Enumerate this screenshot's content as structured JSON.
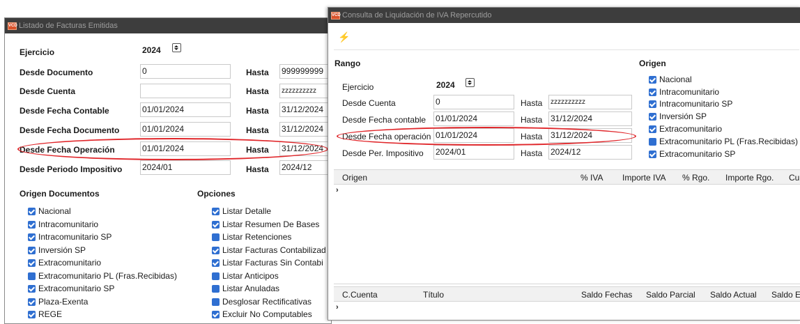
{
  "win1": {
    "title": "Listado de Facturas Emitidas",
    "ejercicio_label": "Ejercicio",
    "ejercicio_value": "2024",
    "hasta_label": "Hasta",
    "rows": [
      {
        "label": "Desde Documento",
        "from": "0",
        "to": "999999999"
      },
      {
        "label": "Desde Cuenta",
        "from": "",
        "to": "zzzzzzzzzz"
      },
      {
        "label": "Desde Fecha Contable",
        "from": "01/01/2024",
        "to": "31/12/2024"
      },
      {
        "label": "Desde Fecha Documento",
        "from": "01/01/2024",
        "to": "31/12/2024"
      },
      {
        "label": "Desde Fecha Operación",
        "from": "01/01/2024",
        "to": "31/12/2024"
      },
      {
        "label": "Desde Periodo Impositivo",
        "from": "2024/01",
        "to": "2024/12"
      }
    ],
    "origen_title": "Origen Documentos",
    "origen_items": [
      "Nacional",
      "Intracomunitario",
      "Intracomunitario SP",
      "Inversión SP",
      "Extracomunitario",
      "Extracomunitario PL (Fras.Recibidas)",
      "Extracomunitario SP",
      "Plaza-Exenta",
      "REGE"
    ],
    "opciones_title": "Opciones",
    "opciones_items": [
      "Listar Detalle",
      "Listar Resumen De Bases",
      "Listar Retenciones",
      "Listar Facturas Contabilizad",
      "Listar Facturas Sin Contabi",
      "Listar Anticipos",
      "Listar Anuladas",
      "Desglosar Rectificativas",
      "Excluir No Computables"
    ]
  },
  "win2": {
    "title": "Consulta de Liquidación de IVA Repercutido",
    "rango_title": "Rango",
    "ejercicio_label": "Ejercicio",
    "ejercicio_value": "2024",
    "hasta_label": "Hasta",
    "rows": [
      {
        "label": "Desde Cuenta",
        "from": "0",
        "to": "zzzzzzzzzz"
      },
      {
        "label": "Desde Fecha contable",
        "from": "01/01/2024",
        "to": "31/12/2024"
      },
      {
        "label": "Desde Fecha operación",
        "from": "01/01/2024",
        "to": "31/12/2024"
      },
      {
        "label": "Desde Per. Impositivo",
        "from": "2024/01",
        "to": "2024/12"
      }
    ],
    "origen_title": "Origen",
    "origen_items": [
      "Nacional",
      "Intracomunitario",
      "Intracomunitario SP",
      "Inversión SP",
      "Extracomunitario",
      "Extracomunitario PL (Fras.Recibidas)",
      "Extracomunitario SP"
    ],
    "grid1_cols": [
      "Origen",
      "% IVA",
      "Importe IVA",
      "% Rgo.",
      "Importe Rgo.",
      "Cu"
    ],
    "grid2_cols": [
      "C.Cuenta",
      "Título",
      "Saldo Fechas",
      "Saldo Parcial",
      "Saldo Actual",
      "Saldo E"
    ],
    "row_marker": "›"
  },
  "colors": {
    "accent": "#2f6fd1",
    "highlight": "#e0262a",
    "titlebar": "#3d3d3d"
  }
}
